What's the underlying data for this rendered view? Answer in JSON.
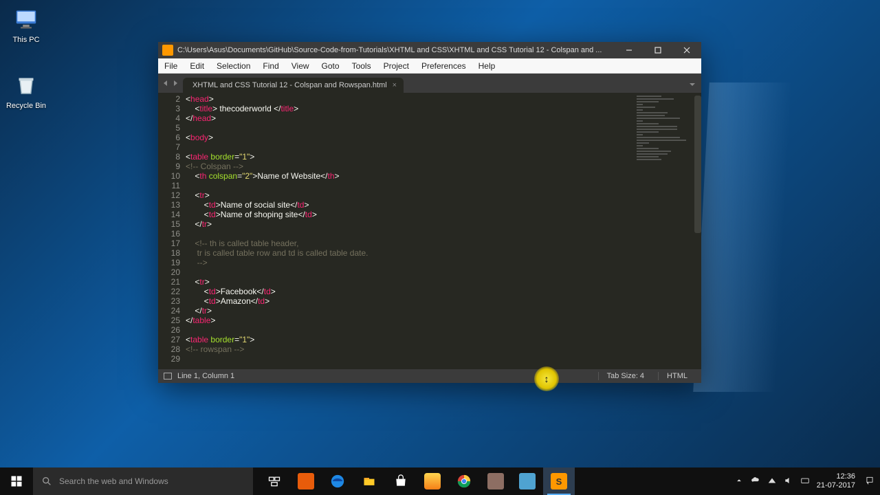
{
  "desktop": {
    "this_pc": "This PC",
    "recycle_bin": "Recycle Bin"
  },
  "editor": {
    "title_path": "C:\\Users\\Asus\\Documents\\GitHub\\Source-Code-from-Tutorials\\XHTML and CSS\\XHTML and CSS Tutorial 12 - Colspan and ...",
    "menus": [
      "File",
      "Edit",
      "Selection",
      "Find",
      "View",
      "Goto",
      "Tools",
      "Project",
      "Preferences",
      "Help"
    ],
    "tab_name": "XHTML and CSS Tutorial 12 - Colspan and Rowspan.html",
    "lines": [
      {
        "n": 2,
        "html": "<span class='t-brk'>&lt;</span><span class='t-tag'>head</span><span class='t-brk'>&gt;</span>"
      },
      {
        "n": 3,
        "html": "    <span class='t-brk'>&lt;</span><span class='t-tag'>title</span><span class='t-brk'>&gt;</span> thecoderworld <span class='t-brk'>&lt;/</span><span class='t-tag'>title</span><span class='t-brk'>&gt;</span>"
      },
      {
        "n": 4,
        "html": "<span class='t-brk'>&lt;/</span><span class='t-tag'>head</span><span class='t-brk'>&gt;</span>"
      },
      {
        "n": 5,
        "html": ""
      },
      {
        "n": 6,
        "html": "<span class='t-brk'>&lt;</span><span class='t-tag'>body</span><span class='t-brk'>&gt;</span>"
      },
      {
        "n": 7,
        "html": ""
      },
      {
        "n": 8,
        "html": "<span class='t-brk'>&lt;</span><span class='t-tag'>table</span> <span class='t-attr'>border</span>=<span class='t-str'>\"1\"</span><span class='t-brk'>&gt;</span>"
      },
      {
        "n": 9,
        "html": "<span class='t-com'>&lt;!-- Colspan --&gt;</span>"
      },
      {
        "n": 10,
        "html": "    <span class='t-brk'>&lt;</span><span class='t-tag'>th</span> <span class='t-attr'>colspan</span>=<span class='t-str'>\"2\"</span><span class='t-brk'>&gt;</span>Name of Website<span class='t-brk'>&lt;/</span><span class='t-tag'>th</span><span class='t-brk'>&gt;</span>"
      },
      {
        "n": 11,
        "html": ""
      },
      {
        "n": 12,
        "html": "    <span class='t-brk'>&lt;</span><span class='t-tag'>tr</span><span class='t-brk'>&gt;</span>"
      },
      {
        "n": 13,
        "html": "        <span class='t-brk'>&lt;</span><span class='t-tag'>td</span><span class='t-brk'>&gt;</span>Name of social site<span class='t-brk'>&lt;/</span><span class='t-tag'>td</span><span class='t-brk'>&gt;</span>"
      },
      {
        "n": 14,
        "html": "        <span class='t-brk'>&lt;</span><span class='t-tag'>td</span><span class='t-brk'>&gt;</span>Name of shoping site<span class='t-brk'>&lt;/</span><span class='t-tag'>td</span><span class='t-brk'>&gt;</span>"
      },
      {
        "n": 15,
        "html": "    <span class='t-brk'>&lt;/</span><span class='t-tag'>tr</span><span class='t-brk'>&gt;</span>"
      },
      {
        "n": 16,
        "html": ""
      },
      {
        "n": 17,
        "html": "    <span class='t-com'>&lt;!-- th is called table header,</span>"
      },
      {
        "n": 18,
        "html": "    <span class='t-com'> tr is called table row and td is called table date.</span>"
      },
      {
        "n": 19,
        "html": "    <span class='t-com'> --&gt;</span>"
      },
      {
        "n": 20,
        "html": ""
      },
      {
        "n": 21,
        "html": "    <span class='t-brk'>&lt;</span><span class='t-tag'>tr</span><span class='t-brk'>&gt;</span>"
      },
      {
        "n": 22,
        "html": "        <span class='t-brk'>&lt;</span><span class='t-tag'>td</span><span class='t-brk'>&gt;</span>Facebook<span class='t-brk'>&lt;/</span><span class='t-tag'>td</span><span class='t-brk'>&gt;</span>"
      },
      {
        "n": 23,
        "html": "        <span class='t-brk'>&lt;</span><span class='t-tag'>td</span><span class='t-brk'>&gt;</span>Amazon<span class='t-brk'>&lt;/</span><span class='t-tag'>td</span><span class='t-brk'>&gt;</span>"
      },
      {
        "n": 24,
        "html": "    <span class='t-brk'>&lt;/</span><span class='t-tag'>tr</span><span class='t-brk'>&gt;</span>"
      },
      {
        "n": 25,
        "html": "<span class='t-brk'>&lt;/</span><span class='t-tag'>table</span><span class='t-brk'>&gt;</span>"
      },
      {
        "n": 26,
        "html": ""
      },
      {
        "n": 27,
        "html": "<span class='t-brk'>&lt;</span><span class='t-tag'>table</span> <span class='t-attr'>border</span>=<span class='t-str'>\"1\"</span><span class='t-brk'>&gt;</span>"
      },
      {
        "n": 28,
        "html": "<span class='t-com'>&lt;!-- rowspan --&gt;</span>"
      },
      {
        "n": 29,
        "html": ""
      }
    ],
    "status": {
      "pos": "Line 1, Column 1",
      "tab": "Tab Size: 4",
      "lang": "HTML"
    }
  },
  "taskbar": {
    "search_placeholder": "Search the web and Windows",
    "time": "12:36",
    "date": "21-07-2017"
  }
}
